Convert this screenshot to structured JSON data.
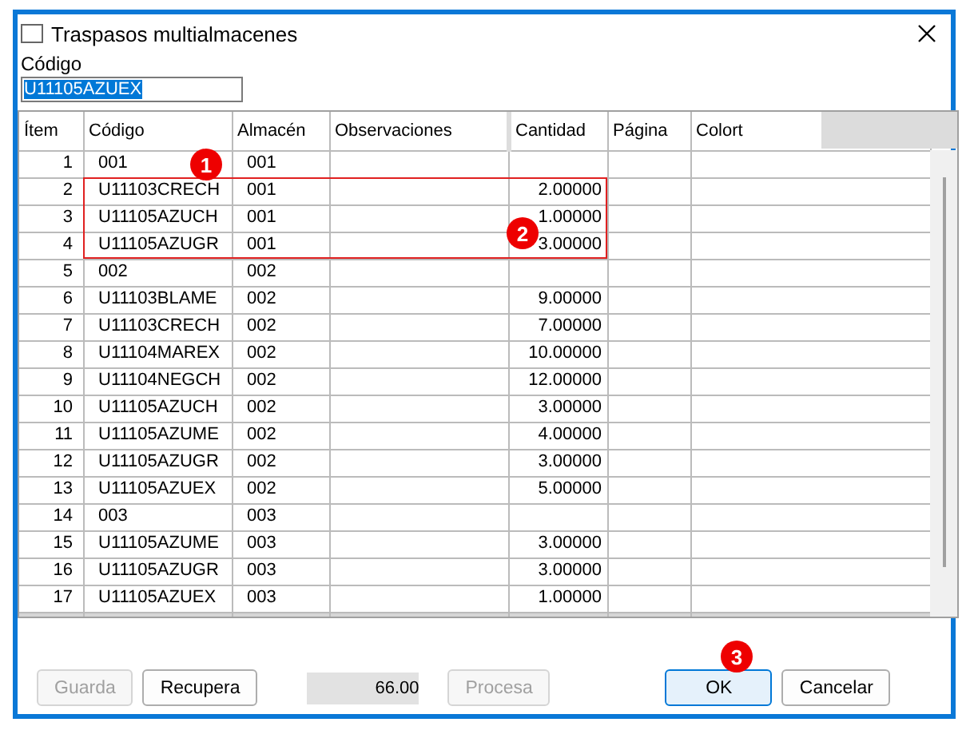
{
  "window": {
    "title": "Traspasos multialmacenes"
  },
  "codigo": {
    "label": "Código",
    "value": "U11105AZUEX"
  },
  "table": {
    "columns": [
      "Ítem",
      "Código",
      "Almacén",
      "Observaciones",
      "Cantidad",
      "Página",
      "Colort"
    ],
    "rows": [
      {
        "item": "1",
        "codigo": "001",
        "almacen": "001",
        "cantidad": "",
        "outlined": false
      },
      {
        "item": "2",
        "codigo": "U11103CRECH",
        "almacen": "001",
        "cantidad": "2.00000",
        "outlined": true
      },
      {
        "item": "3",
        "codigo": "U11105AZUCH",
        "almacen": "001",
        "cantidad": "1.00000",
        "outlined": true
      },
      {
        "item": "4",
        "codigo": "U11105AZUGR",
        "almacen": "001",
        "cantidad": "3.00000",
        "outlined": true
      },
      {
        "item": "5",
        "codigo": "002",
        "almacen": "002",
        "cantidad": "",
        "outlined": false
      },
      {
        "item": "6",
        "codigo": "U11103BLAME",
        "almacen": "002",
        "cantidad": "9.00000",
        "outlined": false
      },
      {
        "item": "7",
        "codigo": "U11103CRECH",
        "almacen": "002",
        "cantidad": "7.00000",
        "outlined": false
      },
      {
        "item": "8",
        "codigo": "U11104MAREX",
        "almacen": "002",
        "cantidad": "10.00000",
        "outlined": false
      },
      {
        "item": "9",
        "codigo": "U11104NEGCH",
        "almacen": "002",
        "cantidad": "12.00000",
        "outlined": false
      },
      {
        "item": "10",
        "codigo": "U11105AZUCH",
        "almacen": "002",
        "cantidad": "3.00000",
        "outlined": false
      },
      {
        "item": "11",
        "codigo": "U11105AZUME",
        "almacen": "002",
        "cantidad": "4.00000",
        "outlined": false
      },
      {
        "item": "12",
        "codigo": "U11105AZUGR",
        "almacen": "002",
        "cantidad": "3.00000",
        "outlined": false
      },
      {
        "item": "13",
        "codigo": "U11105AZUEX",
        "almacen": "002",
        "cantidad": "5.00000",
        "outlined": false
      },
      {
        "item": "14",
        "codigo": "003",
        "almacen": "003",
        "cantidad": "",
        "outlined": false
      },
      {
        "item": "15",
        "codigo": "U11105AZUME",
        "almacen": "003",
        "cantidad": "3.00000",
        "outlined": false
      },
      {
        "item": "16",
        "codigo": "U11105AZUGR",
        "almacen": "003",
        "cantidad": "3.00000",
        "outlined": false
      },
      {
        "item": "17",
        "codigo": "U11105AZUEX",
        "almacen": "003",
        "cantidad": "1.00000",
        "outlined": false
      }
    ]
  },
  "buttons": [
    {
      "kind": "button",
      "label": "Guarda",
      "disabled": true
    },
    {
      "kind": "button",
      "label": "Recupera",
      "disabled": false
    },
    {
      "kind": "total",
      "label": "66.00"
    },
    {
      "kind": "button",
      "label": "Procesa",
      "disabled": true
    }
  ],
  "dialog_buttons": [
    {
      "label": "OK",
      "selected": true
    },
    {
      "label": "Cancelar",
      "selected": false
    }
  ],
  "annotations": [
    {
      "label": "1"
    },
    {
      "label": "2"
    },
    {
      "label": "3"
    }
  ]
}
